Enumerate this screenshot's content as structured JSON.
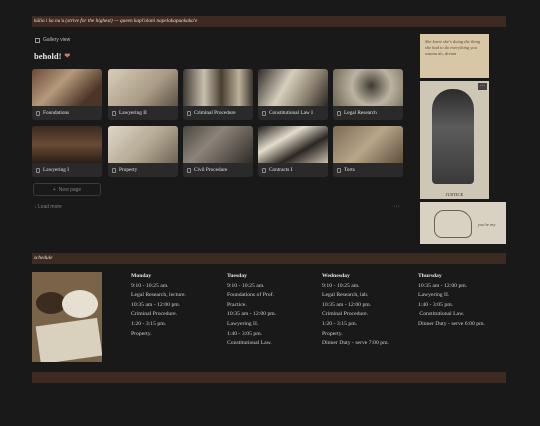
{
  "banner_top": "kūlia i ka nu'u (strive for the highest) — queen kapi'olani napelakapuokaka'e",
  "gallery": {
    "view_label": "Gallery view",
    "title": "behold!",
    "cards": [
      {
        "label": "Foundations"
      },
      {
        "label": "Lawyering II"
      },
      {
        "label": "Criminal Procedure"
      },
      {
        "label": "Constitutional Law I"
      },
      {
        "label": "Legal Research"
      },
      {
        "label": "Lawyering I"
      },
      {
        "label": "Property"
      },
      {
        "label": "Civil Procedure"
      },
      {
        "label": "Contracts I"
      },
      {
        "label": "Torts"
      }
    ],
    "new_page": "New page",
    "load_more": "Load more",
    "more_dots": "···"
  },
  "side": {
    "note_text": "She knew she's doing the thing she had to do everything you wanna do, dream",
    "poster_caption": "JUSTICE",
    "sketch_text": "you're my"
  },
  "schedule_banner": "schedule",
  "schedule": [
    {
      "day": "Monday",
      "lines": [
        "9:10 - 10:25 am.",
        "Legal Research, lecture.",
        "10:35 am - 12:00 pm.",
        "Criminal Procedure.",
        "1:20 - 3:15 pm.",
        "Property."
      ]
    },
    {
      "day": "Tuesday",
      "lines": [
        "9:10 - 10:25 am.",
        "Foundations of Prof.",
        "Practice.",
        "10:35 am - 12:00 pm.",
        "Lawyering II.",
        "1:40 - 3:05 pm.",
        "Constitutional Law."
      ]
    },
    {
      "day": "Wednesday",
      "lines": [
        "9:10 - 10:25 am.",
        "Legal Research, lab.",
        "10:35 am - 12:00 pm.",
        "Criminal Procedure.",
        "1:20 - 3:15 pm.",
        "Property.",
        "Dinner Duty - serve 7:00 pm."
      ]
    },
    {
      "day": "Thursday",
      "lines": [
        "10:35 am - 12:00 pm.",
        "Lawyering II.",
        "1:40 - 3:05 pm.",
        " Constitutional Law.",
        "Dinner Duty - serve 6:00 pm."
      ]
    }
  ]
}
